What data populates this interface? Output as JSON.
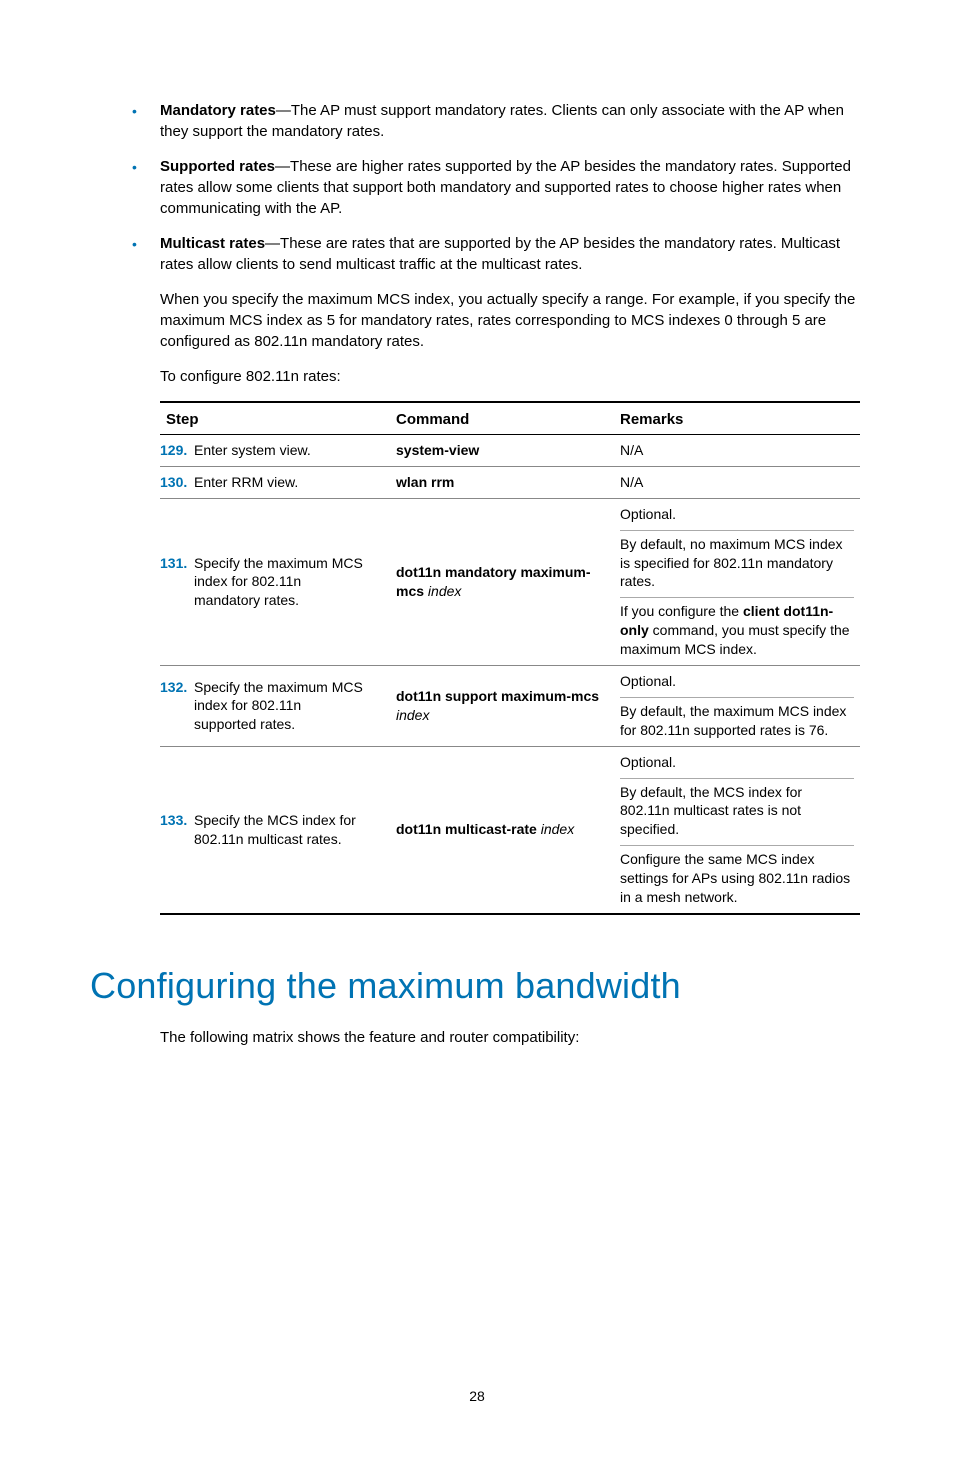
{
  "bullets": [
    {
      "label": "Mandatory rates",
      "text": "—The AP must support mandatory rates. Clients can only associate with the AP when they support the mandatory rates."
    },
    {
      "label": "Supported rates",
      "text": "—These are higher rates supported by the AP besides the mandatory rates. Supported rates allow some clients that support both mandatory and supported rates to choose higher rates when communicating with the AP."
    },
    {
      "label": "Multicast rates",
      "text": "—These are rates that are supported by the AP besides the mandatory rates. Multicast rates allow clients to send multicast traffic at the multicast rates."
    }
  ],
  "paragraphs": {
    "mcs_range": "When you specify the maximum MCS index, you actually specify a range. For example, if you specify the maximum MCS index as 5 for mandatory rates, rates corresponding to MCS indexes 0 through 5 are configured as 802.11n mandatory rates.",
    "configure_intro": "To configure 802.11n rates:",
    "matrix_intro": "The following matrix shows the feature and router compatibility:"
  },
  "table": {
    "headers": {
      "step": "Step",
      "command": "Command",
      "remarks": "Remarks"
    },
    "rows": [
      {
        "num": "129.",
        "step": "Enter system view.",
        "cmd_bold": "system-view",
        "cmd_italic": "",
        "remarks": [
          {
            "text": "N/A"
          }
        ]
      },
      {
        "num": "130.",
        "step": "Enter RRM view.",
        "cmd_bold": "wlan rrm",
        "cmd_italic": "",
        "remarks": [
          {
            "text": "N/A"
          }
        ]
      },
      {
        "num": "131.",
        "step": "Specify the maximum MCS index for 802.11n mandatory rates.",
        "cmd_bold": "dot11n mandatory maximum-mcs",
        "cmd_italic": "index",
        "remarks": [
          {
            "text": "Optional."
          },
          {
            "text": "By default, no maximum MCS index is specified for 802.11n mandatory rates."
          },
          {
            "pre": "If you configure the ",
            "bold": "client dot11n-only",
            "post": " command, you must specify the maximum MCS index."
          }
        ]
      },
      {
        "num": "132.",
        "step": "Specify the maximum MCS index for 802.11n supported rates.",
        "cmd_bold": "dot11n support maximum-mcs",
        "cmd_italic": "index",
        "remarks": [
          {
            "text": "Optional."
          },
          {
            "text": "By default, the maximum MCS index for 802.11n supported rates is 76."
          }
        ]
      },
      {
        "num": "133.",
        "step": "Specify the MCS index for 802.11n multicast rates.",
        "cmd_bold": "dot11n multicast-rate",
        "cmd_italic": "index",
        "remarks": [
          {
            "text": "Optional."
          },
          {
            "text": "By default, the MCS index for 802.11n multicast rates is not specified."
          },
          {
            "text": "Configure the same MCS index settings for APs using 802.11n radios in a mesh network."
          }
        ]
      }
    ]
  },
  "heading": "Configuring the maximum bandwidth",
  "page_number": "28"
}
